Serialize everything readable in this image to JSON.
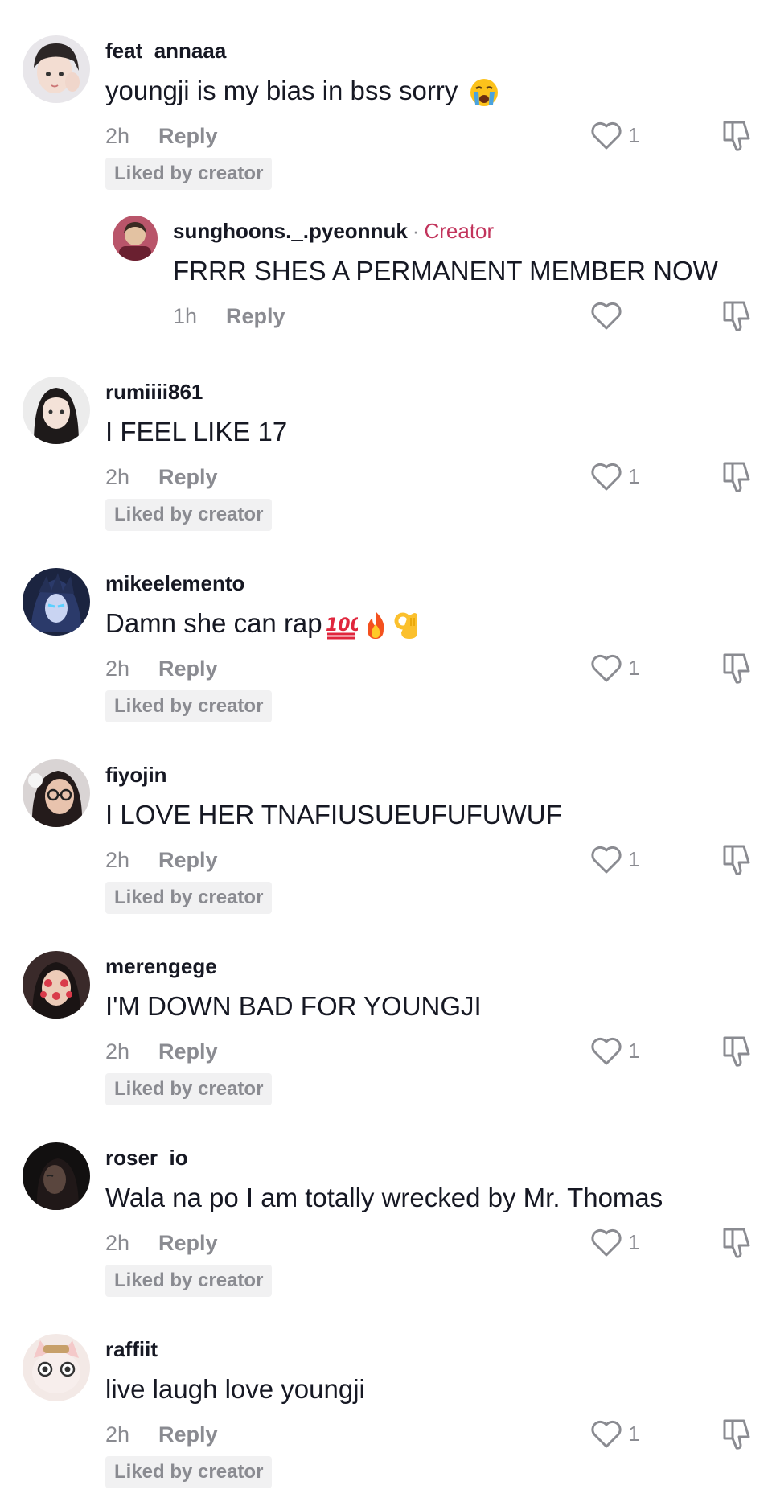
{
  "comments_top": {
    "username": "feat_annaaa",
    "text": "youngji is my bias in bss sorry",
    "emoji": "loudly-crying-face",
    "time": "2h",
    "reply_label": "Reply",
    "likes": "1",
    "liked_badge": "Liked by creator"
  },
  "creator_reply": {
    "username": "sunghoons._.pyeonnuk",
    "separator": "·",
    "creator_label": "Creator",
    "text": "FRRR SHES A PERMANENT MEMBER NOW",
    "time": "1h",
    "reply_label": "Reply"
  },
  "comments": [
    {
      "username": "rumiiii861",
      "text": "I FEEL LIKE 17",
      "time": "2h",
      "reply_label": "Reply",
      "likes": "1",
      "liked_badge": "Liked by creator"
    },
    {
      "username": "mikeelemento",
      "text": "Damn she can rap",
      "emojis": [
        "hundred-points",
        "fire",
        "ok-hand"
      ],
      "time": "2h",
      "reply_label": "Reply",
      "likes": "1",
      "liked_badge": "Liked by creator"
    },
    {
      "username": "fiyojin",
      "text": "I LOVE HER TNAFIUSUEUFUFUWUF",
      "time": "2h",
      "reply_label": "Reply",
      "likes": "1",
      "liked_badge": "Liked by creator"
    },
    {
      "username": "merengege",
      "text": "I'M DOWN BAD FOR YOUNGJI",
      "time": "2h",
      "reply_label": "Reply",
      "likes": "1",
      "liked_badge": "Liked by creator"
    },
    {
      "username": "roser_io",
      "text": "Wala na po I am totally wrecked by Mr. Thomas",
      "time": "2h",
      "reply_label": "Reply",
      "likes": "1",
      "liked_badge": "Liked by creator"
    },
    {
      "username": "raffiit",
      "text": "live laugh love youngji",
      "time": "2h",
      "reply_label": "Reply",
      "likes": "1",
      "liked_badge": "Liked by creator"
    }
  ],
  "colors": {
    "text": "#161823",
    "muted": "#8a8b91",
    "creator": "#c2345c",
    "badge_bg": "#f1f1f2"
  },
  "icons": {
    "like": "heart-outline-icon",
    "dislike": "thumbs-down-icon"
  }
}
